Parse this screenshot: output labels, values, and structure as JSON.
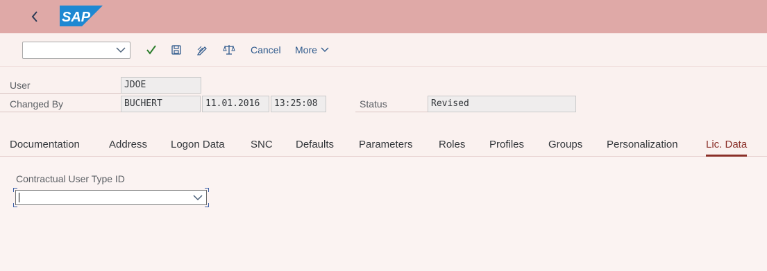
{
  "shell": {
    "logo_text": "SAP"
  },
  "toolbar": {
    "command_field_value": "",
    "cancel_label": "Cancel",
    "more_label": "More"
  },
  "header": {
    "user_label": "User",
    "user_value": "JDOE",
    "changed_by_label": "Changed By",
    "changed_by_value": "BUCHERT",
    "changed_date": "11.01.2016",
    "changed_time": "13:25:08",
    "status_label": "Status",
    "status_value": "Revised"
  },
  "tabs": [
    {
      "label": "Documentation"
    },
    {
      "label": "Address"
    },
    {
      "label": "Logon Data"
    },
    {
      "label": "SNC"
    },
    {
      "label": "Defaults"
    },
    {
      "label": "Parameters"
    },
    {
      "label": "Roles"
    },
    {
      "label": "Profiles"
    },
    {
      "label": "Groups"
    },
    {
      "label": "Personalization"
    },
    {
      "label": "Lic. Data",
      "active": true
    }
  ],
  "lic_data": {
    "contract_type_label": "Contractual User Type ID",
    "contract_type_value": ""
  },
  "colors": {
    "shell_bg": "#dfa9a7",
    "page_bg": "#faf1ef",
    "link_blue": "#2f5a8c",
    "check_green": "#2b7d2b",
    "active_tab": "#8a2f28"
  }
}
